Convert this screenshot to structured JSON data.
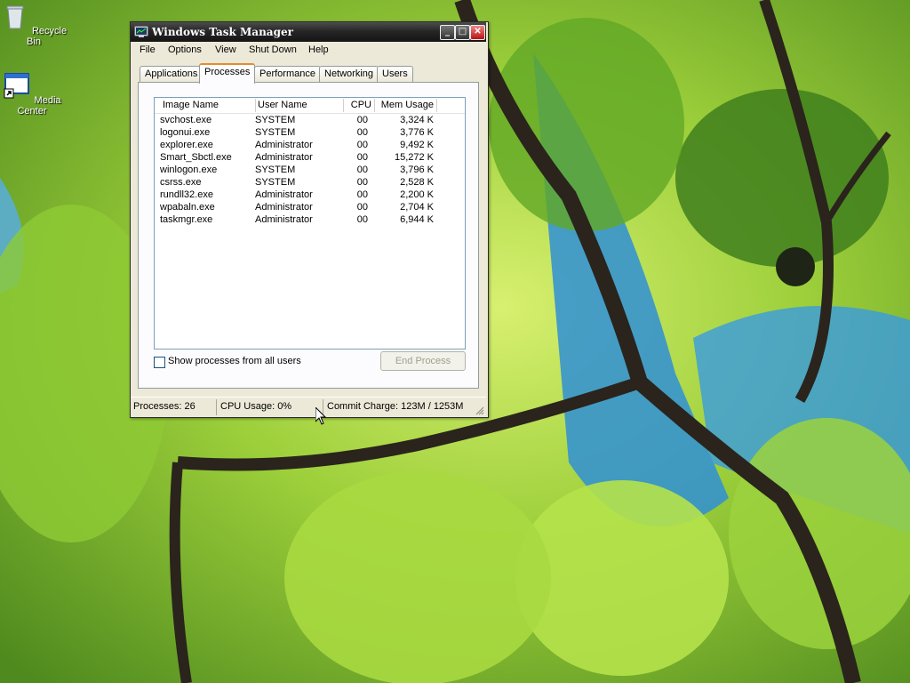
{
  "desktop": {
    "icons": [
      {
        "label": "Recycle Bin",
        "icon": "recycle-bin-icon"
      },
      {
        "label": "Media Center",
        "icon": "media-center-shortcut-icon"
      }
    ]
  },
  "window": {
    "title": "Windows Task Manager",
    "controls": {
      "minimize": "_",
      "maximize": "□",
      "close": "✕"
    }
  },
  "menu": [
    "File",
    "Options",
    "View",
    "Shut Down",
    "Help"
  ],
  "tabs": [
    {
      "label": "Applications",
      "active": false
    },
    {
      "label": "Processes",
      "active": true
    },
    {
      "label": "Performance",
      "active": false
    },
    {
      "label": "Networking",
      "active": false
    },
    {
      "label": "Users",
      "active": false
    }
  ],
  "process_list": {
    "columns": [
      "Image Name",
      "User Name",
      "CPU",
      "Mem Usage"
    ],
    "rows": [
      {
        "image": "svchost.exe",
        "user": "SYSTEM",
        "cpu": "00",
        "mem": "3,324 K"
      },
      {
        "image": "logonui.exe",
        "user": "SYSTEM",
        "cpu": "00",
        "mem": "3,776 K"
      },
      {
        "image": "explorer.exe",
        "user": "Administrator",
        "cpu": "00",
        "mem": "9,492 K"
      },
      {
        "image": "Smart_Sbctl.exe",
        "user": "Administrator",
        "cpu": "00",
        "mem": "15,272 K"
      },
      {
        "image": "winlogon.exe",
        "user": "SYSTEM",
        "cpu": "00",
        "mem": "3,796 K"
      },
      {
        "image": "csrss.exe",
        "user": "SYSTEM",
        "cpu": "00",
        "mem": "2,528 K"
      },
      {
        "image": "rundll32.exe",
        "user": "Administrator",
        "cpu": "00",
        "mem": "2,200 K"
      },
      {
        "image": "wpabaln.exe",
        "user": "Administrator",
        "cpu": "00",
        "mem": "2,704 K"
      },
      {
        "image": "taskmgr.exe",
        "user": "Administrator",
        "cpu": "00",
        "mem": "6,944 K"
      }
    ]
  },
  "options": {
    "show_all_users": {
      "label": "Show processes from all users",
      "checked": false
    },
    "end_process": {
      "label": "End Process",
      "enabled": false
    }
  },
  "status": {
    "processes": "Processes: 26",
    "cpu": "CPU Usage: 0%",
    "commit": "Commit Charge: 123M / 1253M"
  },
  "colors": {
    "title_bar": "#262626",
    "window_face": "#ece9d8",
    "active_tab_accent": "#e68b2c",
    "wallpaper_leaf": "#8cc63f",
    "wallpaper_sky": "#2f8fd6"
  }
}
